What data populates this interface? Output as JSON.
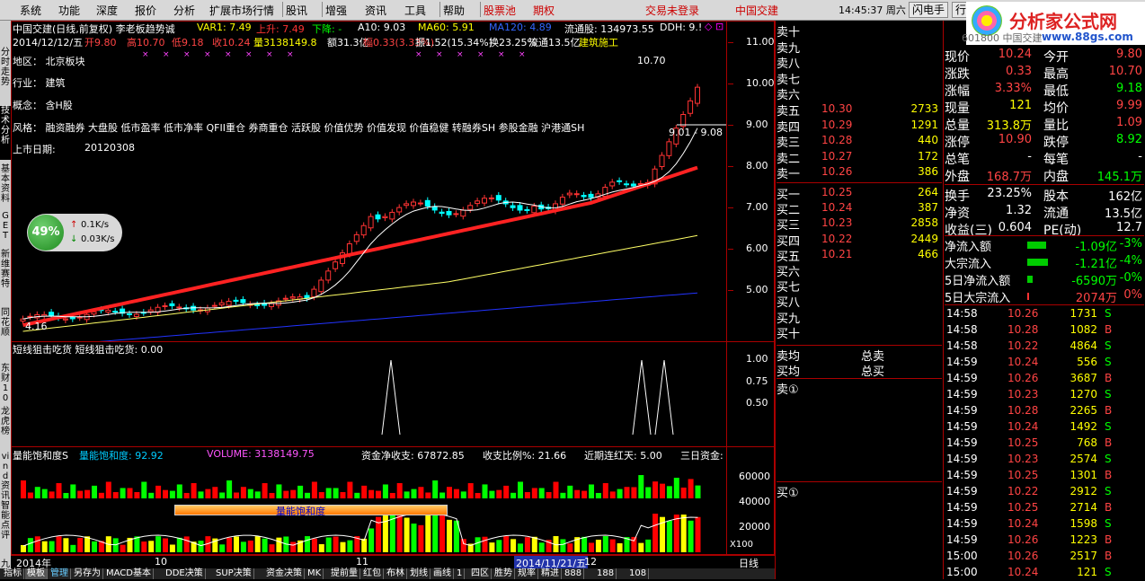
{
  "menu": {
    "items": [
      "系统",
      "功能",
      "深度",
      "报价",
      "分析",
      "扩展市场行情",
      "股讯",
      "增强",
      "资讯",
      "工具",
      "帮助",
      "股票池",
      "期权"
    ],
    "status_login": "交易未登录",
    "status_stock": "中国交建",
    "clock": "14:45:37 周六",
    "btn_flash": "闪电手",
    "btn_more": "行"
  },
  "left_tabs": [
    "分时走势",
    "技术分析",
    "基本资料",
    "GET",
    "新维赛特",
    "同花顺",
    "东财10",
    "龙虎榜",
    "vi nd 资讯",
    "智能点评",
    "九宫"
  ],
  "header": {
    "line1": [
      {
        "t": "中国交建(日线,前复权) 李老板趋势诚",
        "c": "#ffffff"
      },
      {
        "t": "VAR1: 7.49",
        "c": "#ffff00"
      },
      {
        "t": "上升: 7.49",
        "c": "#ff3333"
      },
      {
        "t": "下降: -",
        "c": "#00ff00"
      },
      {
        "t": "A10: 9.03",
        "c": "#ffffff"
      },
      {
        "t": "MA60: 5.91",
        "c": "#ffff00"
      },
      {
        "t": "MA120: 4.89",
        "c": "#3366ff"
      },
      {
        "t": "流通股: 134973.55",
        "c": "#ffffff"
      },
      {
        "t": "DDH: 9.!",
        "c": "#ffffff"
      }
    ],
    "line2": [
      {
        "t": "2014/12/12/五",
        "c": "#ffffff"
      },
      {
        "t": "开9.80",
        "c": "#ff4444"
      },
      {
        "t": "高10.70",
        "c": "#ff4444"
      },
      {
        "t": "低9.18",
        "c": "#ff4444"
      },
      {
        "t": "收10.24",
        "c": "#ff4444"
      },
      {
        "t": "量3138149.8",
        "c": "#ffff00"
      },
      {
        "t": "额31.3亿",
        "c": "#ffffff"
      },
      {
        "t": "幅0.33(3.33%)",
        "c": "#ff4444"
      },
      {
        "t": "振1.52(15.34%)",
        "c": "#ffffff"
      },
      {
        "t": "换23.25%",
        "c": "#ffffff"
      },
      {
        "t": "流通13.5亿",
        "c": "#ffffff"
      },
      {
        "t": "建筑施工",
        "c": "#ffff00"
      }
    ]
  },
  "info": {
    "region": "地区： 北京板块",
    "industry": "行业： 建筑",
    "concept": "概念： 含H股",
    "style": "风格： 融资融券 大盘股 低市盈率 低市净率 QFII重仓 券商重仓 活跃股 价值优势 价值发现 价值稳健 转融券SH 参股金融 沪港通SH",
    "listing_label": "上市日期:",
    "listing_date": "20120308",
    "high_mark": "10.70",
    "low_mark": "4.16",
    "range_mark": "9.01 - 9.08"
  },
  "badge": {
    "pct": "49%",
    "up": "0.1K/s",
    "down": "0.03K/s"
  },
  "price_axis": [
    "11.00",
    "10.00",
    "9.00",
    "8.00",
    "7.00",
    "6.00",
    "5.00"
  ],
  "pane2": {
    "title": "短线狙击吃货  短线狙击吃货: 0.00",
    "axis": [
      "1.00",
      "0.75",
      "0.50"
    ]
  },
  "pane3": {
    "items": [
      {
        "t": "量能饱和度S",
        "c": "#ffffff"
      },
      {
        "t": "量能饱和度: 92.92",
        "c": "#00ccff"
      },
      {
        "t": "VOLUME: 3138149.75",
        "c": "#ff55ff"
      },
      {
        "t": "资金净收支: 67872.85",
        "c": "#ffffff"
      },
      {
        "t": "收支比例%: 21.66",
        "c": "#ffffff"
      },
      {
        "t": "近期连红天: 5.00",
        "c": "#ffffff"
      },
      {
        "t": "三日资金:",
        "c": "#ffffff"
      }
    ],
    "axis": [
      "60000",
      "40000",
      "20000"
    ],
    "unit": "X100",
    "bar_label": "量能饱和度"
  },
  "xaxis": {
    "left": "2014年",
    "m10": "10",
    "m11": "11",
    "cursor": "2014/11/21/五",
    "m12": "12",
    "period": "日线"
  },
  "bottom_tabs": [
    "指标",
    "模板",
    "管理",
    "另存为",
    "MACD基本",
    "DDE决策",
    "SUP决策",
    "资金决策",
    "MK",
    "提前量",
    "红包",
    "布林",
    "划线",
    "画线",
    "1",
    "四区",
    "胜势",
    "规率",
    "精进",
    "888",
    "188",
    "108"
  ],
  "orderbook": {
    "sells": [
      {
        "label": "卖十",
        "price": "",
        "vol": ""
      },
      {
        "label": "卖九",
        "price": "",
        "vol": ""
      },
      {
        "label": "卖八",
        "price": "",
        "vol": ""
      },
      {
        "label": "卖七",
        "price": "",
        "vol": ""
      },
      {
        "label": "卖六",
        "price": "",
        "vol": ""
      },
      {
        "label": "卖五",
        "price": "10.30",
        "vol": "2733"
      },
      {
        "label": "卖四",
        "price": "10.29",
        "vol": "1291"
      },
      {
        "label": "卖三",
        "price": "10.28",
        "vol": "440"
      },
      {
        "label": "卖二",
        "price": "10.27",
        "vol": "172"
      },
      {
        "label": "卖一",
        "price": "10.26",
        "vol": "386"
      }
    ],
    "buys": [
      {
        "label": "买一",
        "price": "10.25",
        "vol": "264"
      },
      {
        "label": "买二",
        "price": "10.24",
        "vol": "387"
      },
      {
        "label": "买三",
        "price": "10.23",
        "vol": "2858"
      },
      {
        "label": "买四",
        "price": "10.22",
        "vol": "2449"
      },
      {
        "label": "买五",
        "price": "10.21",
        "vol": "466"
      },
      {
        "label": "买六",
        "price": "",
        "vol": ""
      },
      {
        "label": "买七",
        "price": "",
        "vol": ""
      },
      {
        "label": "买八",
        "price": "",
        "vol": ""
      },
      {
        "label": "买九",
        "price": "",
        "vol": ""
      },
      {
        "label": "买十",
        "price": "",
        "vol": ""
      }
    ],
    "avg_sell": "卖均",
    "total_sell": "总卖",
    "avg_buy": "买均",
    "total_buy": "总买",
    "sell_1": "卖①",
    "buy_1": "买①"
  },
  "quote": [
    {
      "l1": "现价",
      "v1": "10.24",
      "c1": "#ff4444",
      "l2": "今开",
      "v2": "9.80",
      "c2": "#ff4444"
    },
    {
      "l1": "涨跌",
      "v1": "0.33",
      "c1": "#ff4444",
      "l2": "最高",
      "v2": "10.70",
      "c2": "#ff4444"
    },
    {
      "l1": "涨幅",
      "v1": "3.33%",
      "c1": "#ff4444",
      "l2": "最低",
      "v2": "9.18",
      "c2": "#00ff00"
    },
    {
      "l1": "现量",
      "v1": "121",
      "c1": "#ffff00",
      "l2": "均价",
      "v2": "9.99",
      "c2": "#ff4444"
    },
    {
      "l1": "总量",
      "v1": "313.8万",
      "c1": "#ffff00",
      "l2": "量比",
      "v2": "1.09",
      "c2": "#ff4444"
    },
    {
      "l1": "涨停",
      "v1": "10.90",
      "c1": "#ff4444",
      "l2": "跌停",
      "v2": "8.92",
      "c2": "#00ff00"
    },
    {
      "l1": "总笔",
      "v1": "-",
      "c1": "#ffffff",
      "l2": "每笔",
      "v2": "-",
      "c2": "#ffffff"
    },
    {
      "l1": "外盘",
      "v1": "168.7万",
      "c1": "#ff4444",
      "l2": "内盘",
      "v2": "145.1万",
      "c2": "#00ff00"
    },
    {
      "l1": "换手",
      "v1": "23.25%",
      "c1": "#ffffff",
      "l2": "股本",
      "v2": "162亿",
      "c2": "#ffffff"
    },
    {
      "l1": "净资",
      "v1": "1.32",
      "c1": "#ffffff",
      "l2": "流通",
      "v2": "13.5亿",
      "c2": "#ffffff"
    },
    {
      "l1": "收益(三)",
      "v1": "0.604",
      "c1": "#ffffff",
      "l2": "PE(动)",
      "v2": "12.7",
      "c2": "#ffffff"
    }
  ],
  "flows": [
    {
      "label": "净流入额",
      "value": "-1.09亿",
      "pct": "-3%",
      "vc": "#00ff00",
      "fill": 0.7,
      "bc": "#00cc00"
    },
    {
      "label": "大宗流入",
      "value": "-1.21亿",
      "pct": "-4%",
      "vc": "#00ff00",
      "fill": 0.75,
      "bc": "#00cc00"
    },
    {
      "label": "5日净流入额",
      "value": "-6590万",
      "pct": "-0%",
      "vc": "#00ff00",
      "fill": 0.2,
      "bc": "#00cc00"
    },
    {
      "label": "5日大宗流入",
      "value": "2074万",
      "pct": "0%",
      "vc": "#ff4444",
      "fill": 0.08,
      "bc": "#ff3333"
    }
  ],
  "ticks": [
    {
      "t": "14:58",
      "p": "10.26",
      "v": "1731",
      "d": "S"
    },
    {
      "t": "14:58",
      "p": "10.28",
      "v": "1082",
      "d": "B"
    },
    {
      "t": "14:58",
      "p": "10.22",
      "v": "4864",
      "d": "S"
    },
    {
      "t": "14:59",
      "p": "10.24",
      "v": "556",
      "d": "S"
    },
    {
      "t": "14:59",
      "p": "10.26",
      "v": "3687",
      "d": "B"
    },
    {
      "t": "14:59",
      "p": "10.23",
      "v": "1270",
      "d": "S"
    },
    {
      "t": "14:59",
      "p": "10.28",
      "v": "2265",
      "d": "B"
    },
    {
      "t": "14:59",
      "p": "10.24",
      "v": "1492",
      "d": "S"
    },
    {
      "t": "14:59",
      "p": "10.25",
      "v": "768",
      "d": "B"
    },
    {
      "t": "14:59",
      "p": "10.23",
      "v": "2574",
      "d": "S"
    },
    {
      "t": "14:59",
      "p": "10.25",
      "v": "1301",
      "d": "B"
    },
    {
      "t": "14:59",
      "p": "10.22",
      "v": "2912",
      "d": "S"
    },
    {
      "t": "14:59",
      "p": "10.25",
      "v": "2714",
      "d": "B"
    },
    {
      "t": "14:59",
      "p": "10.24",
      "v": "1598",
      "d": "S"
    },
    {
      "t": "14:59",
      "p": "10.26",
      "v": "1223",
      "d": "B"
    },
    {
      "t": "15:00",
      "p": "10.26",
      "v": "2517",
      "d": "B"
    },
    {
      "t": "15:00",
      "p": "10.24",
      "v": "121",
      "d": "S"
    }
  ],
  "watermark": {
    "brand": "分析家公式网",
    "url": "www.88gs.com",
    "code": "601800 中国交建"
  }
}
